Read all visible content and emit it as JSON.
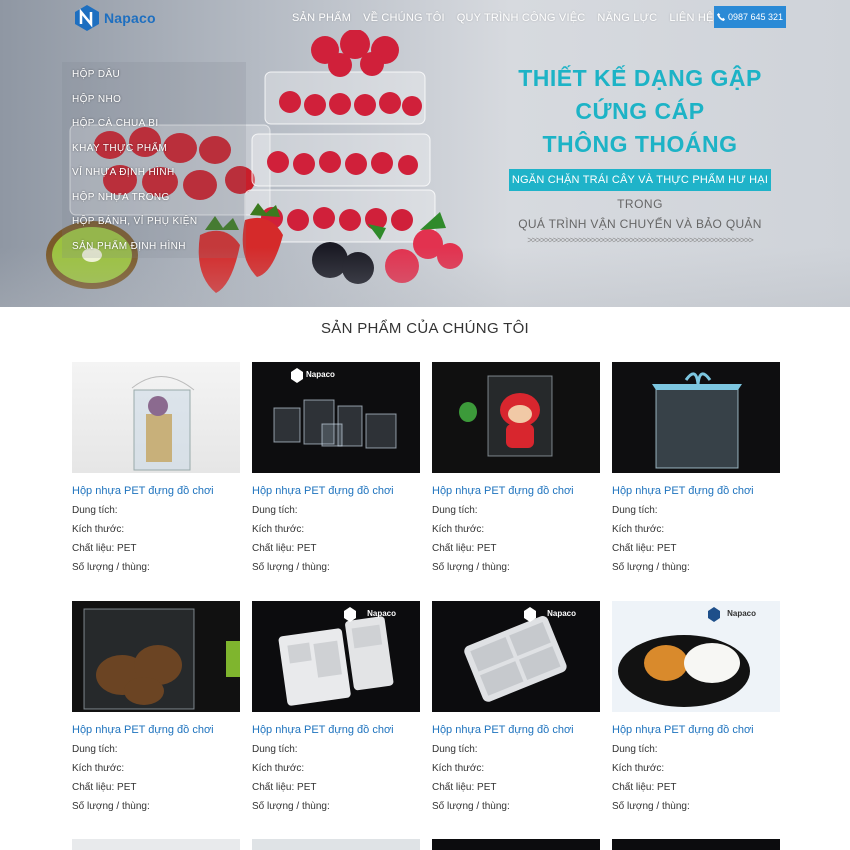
{
  "header": {
    "logo_text": "Napaco",
    "nav": [
      "SẢN PHẨM",
      "VỀ CHÚNG TÔI",
      "QUY TRÌNH CÔNG VIỆC",
      "NĂNG LỰC",
      "LIÊN HỆ"
    ],
    "phone": "0987 645 321"
  },
  "side_menu": [
    "HỘP DÂU",
    "HỘP NHO",
    "HỘP CÀ CHUA BI",
    "KHAY THỰC PHẨM",
    "VỈ NHỰA ĐỊNH HÌNH",
    "HỘP NHỰA TRONG",
    "HỘP BÁNH, VỈ PHỤ KIỆN",
    "SẢN PHẨM ĐỊNH HÌNH"
  ],
  "hero": {
    "line1": "THIẾT KẾ DẠNG GẬP",
    "line2": "CỨNG CÁP",
    "line3": "THÔNG THOÁNG",
    "banner": "NGĂN CHẶN TRÁI CÂY VÀ THỰC PHẨM HƯ HẠI",
    "trong": "TRONG",
    "process": "QUÁ TRÌNH VẬN CHUYỂN VÀ BẢO QUẢN",
    "arrows": ">>>>>>>>>>>>>>>>>>>>>>>>>>>>>>>>>>>>>>>>>>>>>>>>>>>>>"
  },
  "section_title": "SẢN PHẨM CỦA CHÚNG TÔI",
  "products": [
    {
      "name": "Hộp nhựa PET đựng đồ chơi",
      "capacity": "Dung tích:",
      "size": "Kích thước:",
      "material": "Chất liệu: PET",
      "qty": "Số lượng / thùng:",
      "brand": ""
    },
    {
      "name": "Hộp nhựa PET đựng đồ chơi",
      "capacity": "Dung tích:",
      "size": "Kích thước:",
      "material": "Chất liệu: PET",
      "qty": "Số lượng / thùng:",
      "brand": "Napaco"
    },
    {
      "name": "Hộp nhựa PET đựng đồ chơi",
      "capacity": "Dung tích:",
      "size": "Kích thước:",
      "material": "Chất liệu: PET",
      "qty": "Số lượng / thùng:",
      "brand": ""
    },
    {
      "name": "Hộp nhựa PET đựng đồ chơi",
      "capacity": "Dung tích:",
      "size": "Kích thước:",
      "material": "Chất liệu: PET",
      "qty": "Số lượng / thùng:",
      "brand": ""
    },
    {
      "name": "Hộp nhựa PET đựng đồ chơi",
      "capacity": "Dung tích:",
      "size": "Kích thước:",
      "material": "Chất liệu: PET",
      "qty": "Số lượng / thùng:",
      "brand": ""
    },
    {
      "name": "Hộp nhựa PET đựng đồ chơi",
      "capacity": "Dung tích:",
      "size": "Kích thước:",
      "material": "Chất liệu: PET",
      "qty": "Số lượng / thùng:",
      "brand": "Napaco"
    },
    {
      "name": "Hộp nhựa PET đựng đồ chơi",
      "capacity": "Dung tích:",
      "size": "Kích thước:",
      "material": "Chất liệu: PET",
      "qty": "Số lượng / thùng:",
      "brand": "Napaco"
    },
    {
      "name": "Hộp nhựa PET đựng đồ chơi",
      "capacity": "Dung tích:",
      "size": "Kích thước:",
      "material": "Chất liệu: PET",
      "qty": "Số lượng / thùng:",
      "brand": "Napaco"
    }
  ],
  "colors": {
    "accent": "#1e73be",
    "teal": "#1db3c6",
    "phone_btn": "#2a8ad6"
  }
}
